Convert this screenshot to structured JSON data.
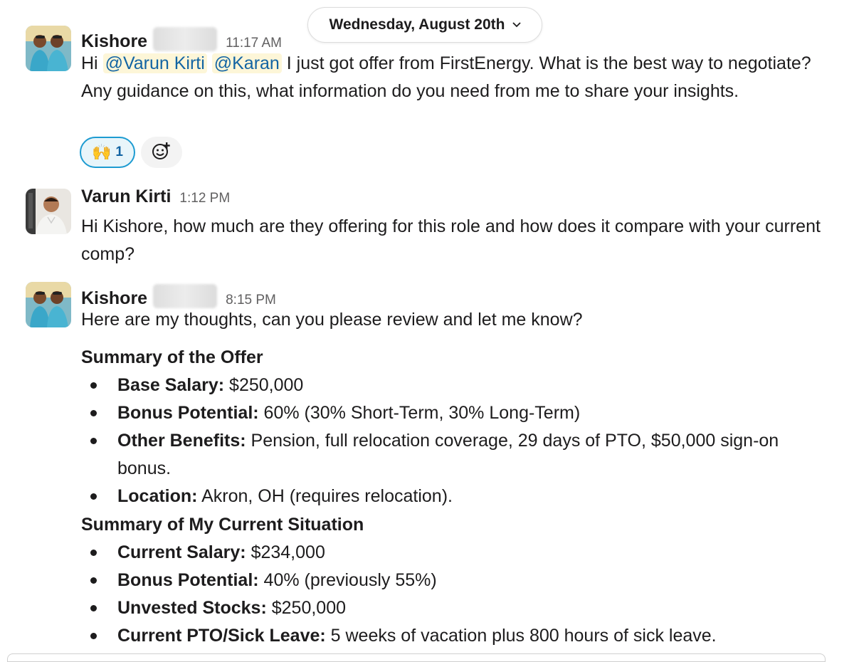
{
  "date_divider": {
    "label": "Wednesday, August 20th",
    "chevron_icon": "chevron-down-icon"
  },
  "messages": [
    {
      "author": "Kishore",
      "time": "11:17 AM",
      "text": {
        "greeting": "Hi ",
        "mention1": "@Varun Kirti",
        "mention2": "@Karan",
        "body": " I just got offer from FirstEnergy. What is the best way to negotiate? Any guidance on this, what information do you need from me to share your insights."
      },
      "reactions": [
        {
          "emoji": "🙌",
          "count": "1"
        }
      ],
      "add_reaction_icon": "add-emoji-icon"
    },
    {
      "author": "Varun Kirti",
      "time": "1:12 PM",
      "text": "Hi Kishore, how much are they offering for this role and how does it compare with your current comp?"
    },
    {
      "author": "Kishore",
      "time": "8:15 PM",
      "intro": "Here are my thoughts, can you please review and let me know?",
      "sections": [
        {
          "heading": "Summary of the Offer",
          "items": [
            {
              "label": "Base Salary:",
              "value": " $250,000"
            },
            {
              "label": "Bonus Potential:",
              "value": " 60% (30% Short-Term, 30% Long-Term)"
            },
            {
              "label": "Other Benefits:",
              "value": " Pension, full relocation coverage, 29 days of PTO, $50,000 sign-on bonus."
            },
            {
              "label": "Location:",
              "value": " Akron, OH (requires relocation)."
            }
          ]
        },
        {
          "heading": "Summary of My Current Situation",
          "items": [
            {
              "label": "Current Salary:",
              "value": " $234,000"
            },
            {
              "label": "Bonus Potential:",
              "value": " 40% (previously 55%)"
            },
            {
              "label": "Unvested Stocks:",
              "value": " $250,000"
            },
            {
              "label": "Current PTO/Sick Leave:",
              "value": " 5 weeks of vacation plus 800 hours of sick leave."
            }
          ]
        }
      ]
    }
  ],
  "colors": {
    "mention_bg": "#fdf6d8",
    "mention_text": "#1264a3",
    "reaction_border": "#1d9bd1",
    "reaction_bg": "#e8f5fa",
    "timestamp": "#616061"
  }
}
